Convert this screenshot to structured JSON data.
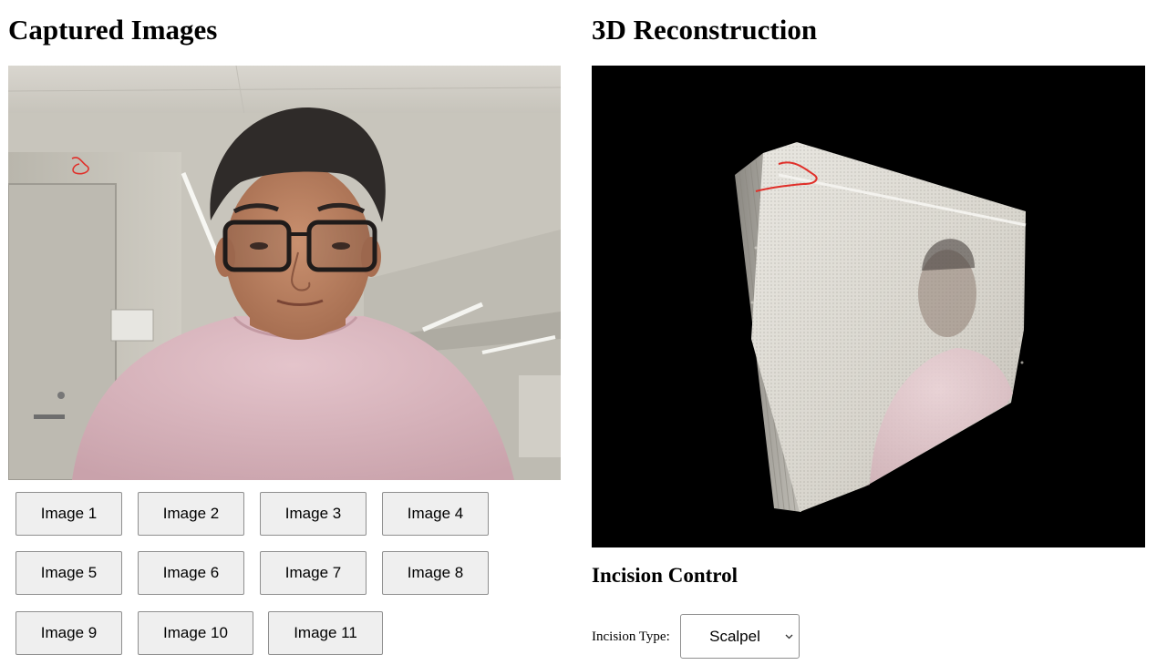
{
  "captured": {
    "title": "Captured Images",
    "buttons": [
      "Image 1",
      "Image 2",
      "Image 3",
      "Image 4",
      "Image 5",
      "Image 6",
      "Image 7",
      "Image 8",
      "Image 9",
      "Image 10",
      "Image 11"
    ]
  },
  "reconstruction": {
    "title": "3D Reconstruction"
  },
  "incision": {
    "title": "Incision Control",
    "type_label": "Incision Type:",
    "selected": "Scalpel"
  },
  "colors": {
    "annotation": "#e0302a",
    "viewport_bg": "#000000",
    "button_bg": "#efefef",
    "button_border": "#8f8f8f"
  }
}
